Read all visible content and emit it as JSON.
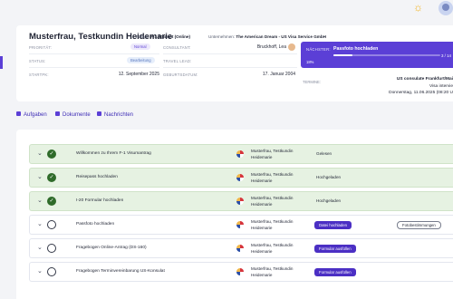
{
  "header": {
    "theme_icon": "sun-icon",
    "user_avatar": "user-avatar"
  },
  "case": {
    "title": "Musterfrau, Testkundin Heidemarie",
    "case_type_label": "Falltyp:",
    "case_type_value": "F-1 Student (Online)",
    "company_label": "Unternehmen:",
    "company_value": "The American Dream - US Visa Service GmbH",
    "fields_left": [
      {
        "label": "PRIORITÄT:",
        "value": "Normal",
        "type": "priority"
      },
      {
        "label": "STATUS:",
        "value": "Bearbeitung",
        "type": "status"
      },
      {
        "label": "STARTPK:",
        "value": "12. September 2025",
        "type": "text"
      }
    ],
    "fields_mid": [
      {
        "label": "CONSULTANT:",
        "value": "Bruckhoff, Lea"
      },
      {
        "label": "TRAVEL LEAD:",
        "value": ""
      },
      {
        "label": "GEBURTSDATUM:",
        "value": "17. Januar 2004"
      }
    ],
    "next_step": {
      "label": "NÄCHSTER:",
      "task": "Passfoto hochladen",
      "counter": "3 / 14",
      "percent_label": "18%",
      "progress_fraction": 0.18
    },
    "appointment": {
      "label": "TERMINE:",
      "lines": [
        "US consulate Frankfurt/Mai",
        "Visa intervie",
        "Donnerstag, 11.06.2025 (08:20 U"
      ]
    }
  },
  "tabs": [
    {
      "label": "Aufgaben",
      "icon": "tasks-icon"
    },
    {
      "label": "Dokumente",
      "icon": "documents-icon"
    },
    {
      "label": "Nachrichten",
      "icon": "messages-icon"
    }
  ],
  "tasks": [
    {
      "title": "Willkommen zu Ihrem F-1 Visumantrag",
      "assignee": "Musterfrau, Testkundin Heidemarie",
      "done": true,
      "status": "Gelesen",
      "action": "",
      "secondary": ""
    },
    {
      "title": "Reisepass hochladen",
      "assignee": "Musterfrau, Testkundin Heidemarie",
      "done": true,
      "status": "Hochgeladen",
      "action": "",
      "secondary": ""
    },
    {
      "title": "I-20 Formular hochladen",
      "assignee": "Musterfrau, Testkundin Heidemarie",
      "done": true,
      "status": "Hochgeladen",
      "action": "",
      "secondary": ""
    },
    {
      "title": "Passfoto hochladen",
      "assignee": "Musterfrau, Testkundin Heidemarie",
      "done": false,
      "status": "",
      "action": "Datei hochladen",
      "secondary": "Fotobestimmungen"
    },
    {
      "title": "Fragebogen Online-Antrag (DS-160)",
      "assignee": "Musterfrau, Testkundin Heidemarie",
      "done": false,
      "status": "",
      "action": "Formular ausfüllen",
      "secondary": ""
    },
    {
      "title": "Fragebogen Terminvereinbarung US-Konsulat",
      "assignee": "Musterfrau, Testkundin Heidemarie",
      "done": false,
      "status": "",
      "action": "Formular ausfüllen",
      "secondary": ""
    }
  ]
}
